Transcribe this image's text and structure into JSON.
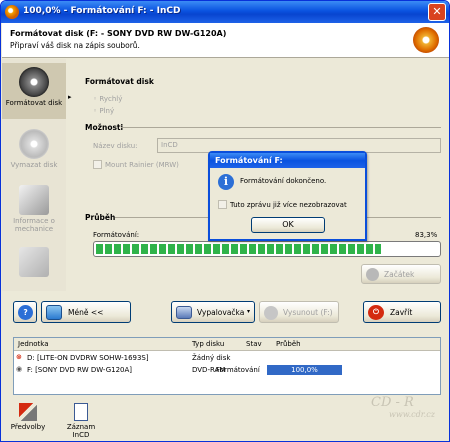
{
  "window": {
    "title": "100,0% - Formátování F: - InCD"
  },
  "header": {
    "title": "Formátovat disk (F: - SONY DVD RW DW-G120A)",
    "subtitle": "Připraví váš disk na zápis souborů."
  },
  "sidebar": {
    "items": [
      {
        "label": "Formátovat disk"
      },
      {
        "label": "Vymazat disk"
      },
      {
        "label": "Informace o mechanice"
      },
      {
        "label": ""
      }
    ]
  },
  "format_section": {
    "title": "Formátovat disk",
    "option_quick": "Rychlý",
    "option_full": "Plný"
  },
  "options_section": {
    "title": "Možnosti",
    "disk_name_label": "Název disku:",
    "disk_name_value": "InCD",
    "mount_rainier_label": "Mount Rainier (MRW)"
  },
  "progress_section": {
    "title": "Průběh",
    "label": "Formátování:",
    "percent_text": "83,3%",
    "fraction": 0.833
  },
  "buttons": {
    "start": "Začátek",
    "help": "?",
    "less": "Méně <<",
    "burner": "Vypalovačka",
    "eject": "Vysunout (F:)",
    "close": "Zavřít"
  },
  "table": {
    "columns": [
      "Jednotka",
      "Typ disku",
      "Stav",
      "Průběh"
    ],
    "rows": [
      {
        "drive": "D: [LITE-ON DVDRW SOHW-1693S]",
        "type": "Žádný disk",
        "status": "",
        "progress": ""
      },
      {
        "drive": "F: [SONY DVD RW DW-G120A]",
        "type": "DVD-RAM",
        "status": "Formátování",
        "progress": "100,0%"
      }
    ]
  },
  "footer": {
    "preferences": "Předvolby",
    "log": "Záznam InCD"
  },
  "watermark": {
    "logo": "CD - R",
    "url": "www.cdr.cz"
  },
  "dialog": {
    "title": "Formátování F:",
    "message": "Formátování dokončeno.",
    "checkbox_label": "Tuto zprávu již více nezobrazovat",
    "ok_label": "OK"
  },
  "colors": {
    "titlebar": "#0A53E0",
    "progress": "#2FB34A",
    "selection": "#3169C6",
    "close_button": "#D9431F"
  }
}
